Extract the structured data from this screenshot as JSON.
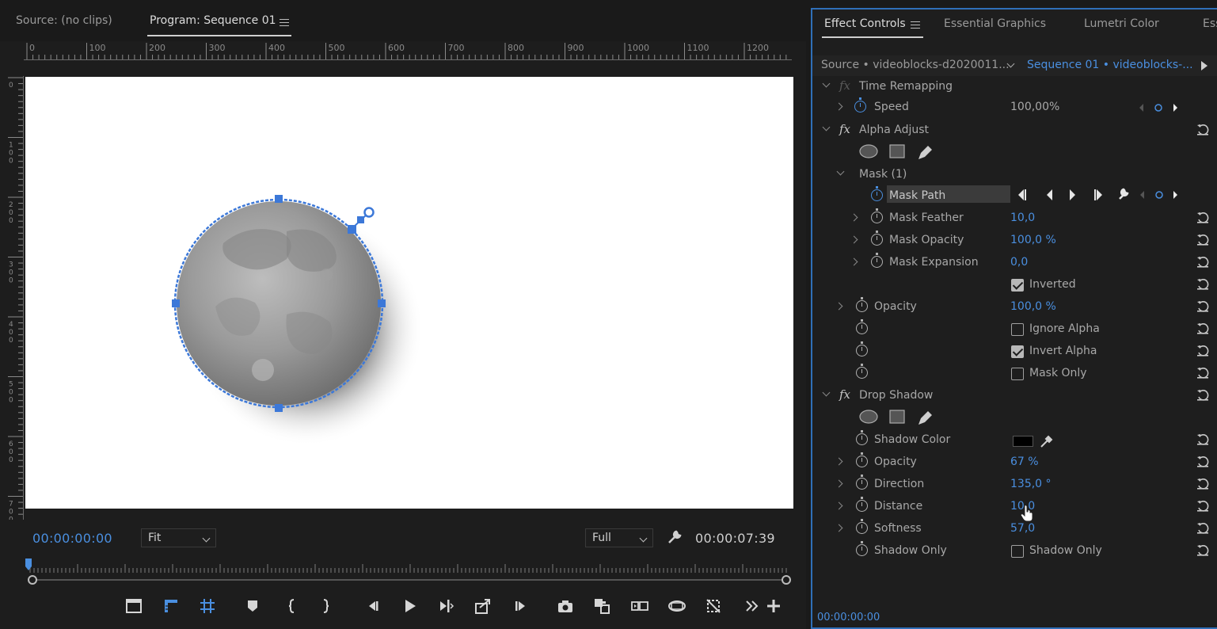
{
  "program_monitor": {
    "tabs": [
      {
        "label": "Source: (no clips)",
        "active": false
      },
      {
        "label": "Program: Sequence 01",
        "active": true
      }
    ],
    "ruler_top_labels": [
      "0",
      "100",
      "200",
      "300",
      "400",
      "500",
      "600",
      "700",
      "800",
      "900",
      "1000",
      "1100",
      "1200"
    ],
    "ruler_left_labels": [
      "0",
      "100",
      "200",
      "300",
      "400",
      "500",
      "600",
      "700"
    ],
    "current_timecode": "00:00:00:00",
    "zoom_select": "Fit",
    "resolution_select": "Full",
    "duration_timecode": "00:00:07:39",
    "transport_icons": [
      "safe-margins-icon",
      "show-ruler-icon",
      "show-guides-icon",
      "add-marker-icon",
      "mark-in-icon",
      "mark-out-icon",
      "go-to-in-icon",
      "step-back-icon",
      "play-icon",
      "step-forward-icon",
      "go-to-out-icon",
      "insert-icon",
      "export-frame-icon",
      "comparison-view-icon",
      "overwrite-icon",
      "vr-video-icon",
      "toggle-proxies-icon",
      "more-controls-icon",
      "add-button-icon"
    ],
    "colors": {
      "accent": "#4a8fe0",
      "mask": "#3c78d8"
    }
  },
  "effect_controls": {
    "tabs": [
      {
        "label": "Effect Controls",
        "active": true
      },
      {
        "label": "Essential Graphics",
        "active": false
      },
      {
        "label": "Lumetri Color",
        "active": false
      },
      {
        "label": "Ess",
        "active": false
      }
    ],
    "source_label": "Source • videoblocks-d2020011...",
    "sequence_label": "Sequence 01 • videoblocks-...",
    "time_remapping": {
      "title": "Time Remapping",
      "speed_label": "Speed",
      "speed_value": "100,00%"
    },
    "alpha_adjust": {
      "title": "Alpha Adjust",
      "mask_title": "Mask (1)",
      "mask_path_label": "Mask Path",
      "mask_feather_label": "Mask Feather",
      "mask_feather_value": "10,0",
      "mask_opacity_label": "Mask Opacity",
      "mask_opacity_value": "100,0 %",
      "mask_expansion_label": "Mask Expansion",
      "mask_expansion_value": "0,0",
      "inverted_label": "Inverted",
      "inverted_checked": true,
      "opacity_label": "Opacity",
      "opacity_value": "100,0 %",
      "ignore_alpha_label": "Ignore Alpha",
      "ignore_alpha_checked": false,
      "invert_alpha_label": "Invert Alpha",
      "invert_alpha_checked": true,
      "mask_only_label": "Mask Only",
      "mask_only_checked": false
    },
    "drop_shadow": {
      "title": "Drop Shadow",
      "shadow_color_label": "Shadow Color",
      "shadow_color": "#000000",
      "opacity_label": "Opacity",
      "opacity_value": "67 %",
      "direction_label": "Direction",
      "direction_value": "135,0 °",
      "distance_label": "Distance",
      "distance_value": "10,0",
      "softness_label": "Softness",
      "softness_value": "57,0",
      "shadow_only_label": "Shadow Only",
      "shadow_only_checkbox_label": "Shadow Only",
      "shadow_only_checked": false
    },
    "footer_timecode": "00:00:00:00"
  }
}
